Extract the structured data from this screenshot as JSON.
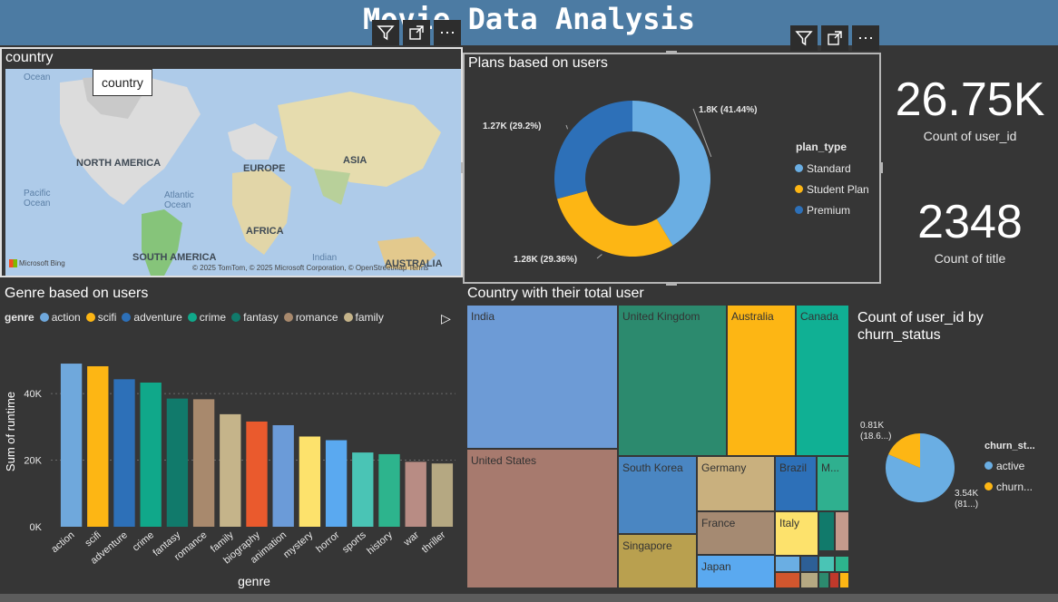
{
  "header": {
    "title": "Movie Data Analysis"
  },
  "toolbar_icons": {
    "filter": "filter-icon",
    "focus": "focus-mode-icon",
    "more": "more-options-icon"
  },
  "map": {
    "title": "country",
    "tooltip": "country",
    "labels": {
      "north_america": "NORTH AMERICA",
      "europe": "EUROPE",
      "asia": "ASIA",
      "africa": "AFRICA",
      "south_america": "SOUTH AMERICA",
      "australia": "AUSTRALIA",
      "pacific": "Pacific\nOcean",
      "atlantic": "Atlantic\nOcean",
      "indian": "Indian",
      "ocean_top": "Ocean"
    },
    "brand": "Microsoft Bing",
    "attribution": "© 2025 TomTom, © 2025 Microsoft Corporation, © OpenStreetMap Terms"
  },
  "kpis": [
    {
      "value": "26.75K",
      "label": "Count of user_id"
    },
    {
      "value": "2348",
      "label": "Count of title"
    }
  ],
  "colors": {
    "action": "#6fa8dc",
    "scifi": "#fdb614",
    "adventure": "#2d70b8",
    "crime": "#10a88a",
    "fantasy": "#117a6b",
    "romance": "#a8896d",
    "family": "#c5b48a",
    "biography": "#ea5a2d",
    "animation": "#6b9bd8",
    "mystery": "#fde26c",
    "horror": "#5aa9f0",
    "sports": "#4ac4b5",
    "history": "#2db48d",
    "war": "#b88c84",
    "thriller": "#b5a882"
  },
  "chart_data": [
    {
      "type": "pie",
      "variant": "donut",
      "title": "Plans based on users",
      "legend_title": "plan_type",
      "legend_position": "right",
      "slices": [
        {
          "name": "Standard",
          "value": 1800,
          "label": "1.8K (41.44%)",
          "color": "#6aaee3"
        },
        {
          "name": "Student Plan",
          "value": 1280,
          "label": "1.28K (29.36%)",
          "color": "#fdb614"
        },
        {
          "name": "Premium",
          "value": 1270,
          "label": "1.27K (29.2%)",
          "color": "#2d70b8"
        }
      ]
    },
    {
      "type": "bar",
      "title": "Genre based on users",
      "legend_title": "genre",
      "legend_entries": [
        "action",
        "scifi",
        "adventure",
        "crime",
        "fantasy",
        "romance",
        "family"
      ],
      "legend_position": "top-left",
      "xlabel": "genre",
      "ylabel": "Sum of runtime",
      "categories": [
        "action",
        "scifi",
        "adventure",
        "crime",
        "fantasy",
        "romance",
        "family",
        "biography",
        "animation",
        "mystery",
        "horror",
        "sports",
        "history",
        "war",
        "thriller"
      ],
      "values": [
        49000,
        48200,
        44300,
        43300,
        38500,
        38300,
        33800,
        31600,
        30500,
        27100,
        26000,
        22300,
        21800,
        19500,
        19000
      ],
      "ylim": [
        0,
        58000
      ],
      "yticks": [
        0,
        20000,
        40000
      ],
      "ytick_labels": [
        "0K",
        "20K",
        "40K"
      ],
      "grid": true
    },
    {
      "type": "treemap",
      "title": "Country with their total user",
      "cells": [
        {
          "name": "India",
          "color": "#6d9bd6"
        },
        {
          "name": "United States",
          "color": "#a77a6e"
        },
        {
          "name": "United Kingdom",
          "color": "#2c8a6e"
        },
        {
          "name": "Australia",
          "color": "#fdb614"
        },
        {
          "name": "Canada",
          "color": "#10b094"
        },
        {
          "name": "South Korea",
          "color": "#4a86c2"
        },
        {
          "name": "Germany",
          "color": "#c9b07e"
        },
        {
          "name": "Brazil",
          "color": "#2d70b8"
        },
        {
          "name": "M...",
          "color": "#2fb08f"
        },
        {
          "name": "France",
          "color": "#a58a72"
        },
        {
          "name": "Italy",
          "color": "#fde26c"
        },
        {
          "name": "Singapore",
          "color": "#b9a04f"
        },
        {
          "name": "Japan",
          "color": "#5aa9f0"
        }
      ]
    },
    {
      "type": "pie",
      "title": "Count of user_id by churn_status",
      "legend_title": "churn_st...",
      "legend_position": "right",
      "slices": [
        {
          "name": "active",
          "value": 3540,
          "label": "3.54K\n(81...)",
          "color": "#6aaee3"
        },
        {
          "name": "churn...",
          "value": 810,
          "label": "0.81K\n(18.6...)",
          "color": "#fdb614"
        }
      ]
    }
  ]
}
